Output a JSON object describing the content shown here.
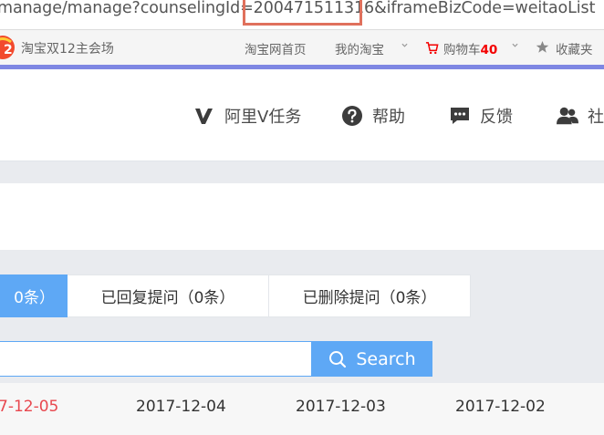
{
  "address_bar": {
    "url_before": "manage/manage?counselingId=",
    "url_highlight": "200471511316",
    "url_after": "&iframeBizCode=weitaoList"
  },
  "taobao_bar": {
    "logo_text": "淘宝双12主会场",
    "home_link": "淘宝网首页",
    "my_taobao_link": "我的淘宝",
    "cart_label": "购物车",
    "cart_count": "40",
    "favorites_link": "收藏夹"
  },
  "header_nav": {
    "items": [
      {
        "icon": "v-icon",
        "label": "阿里V任务"
      },
      {
        "icon": "help-icon",
        "label": "帮助"
      },
      {
        "icon": "chat-icon",
        "label": "反馈"
      },
      {
        "icon": "users-icon",
        "label": "社"
      }
    ]
  },
  "tabs": {
    "active_label": "0条）",
    "replied_label": "已回复提问（0条）",
    "deleted_label": "已删除提问（0条）"
  },
  "search": {
    "value": "",
    "placeholder": "",
    "button_label": "Search"
  },
  "dates": {
    "items": [
      "7-12-05",
      "2017-12-04",
      "2017-12-03",
      "2017-12-02"
    ],
    "selected_index": 0
  },
  "colors": {
    "accent_blue": "#5ea8f5",
    "accent_line": "#7e87e3",
    "highlight_red": "#e0705c",
    "selected_date": "#e8484f",
    "cart_count": "#f40000"
  }
}
